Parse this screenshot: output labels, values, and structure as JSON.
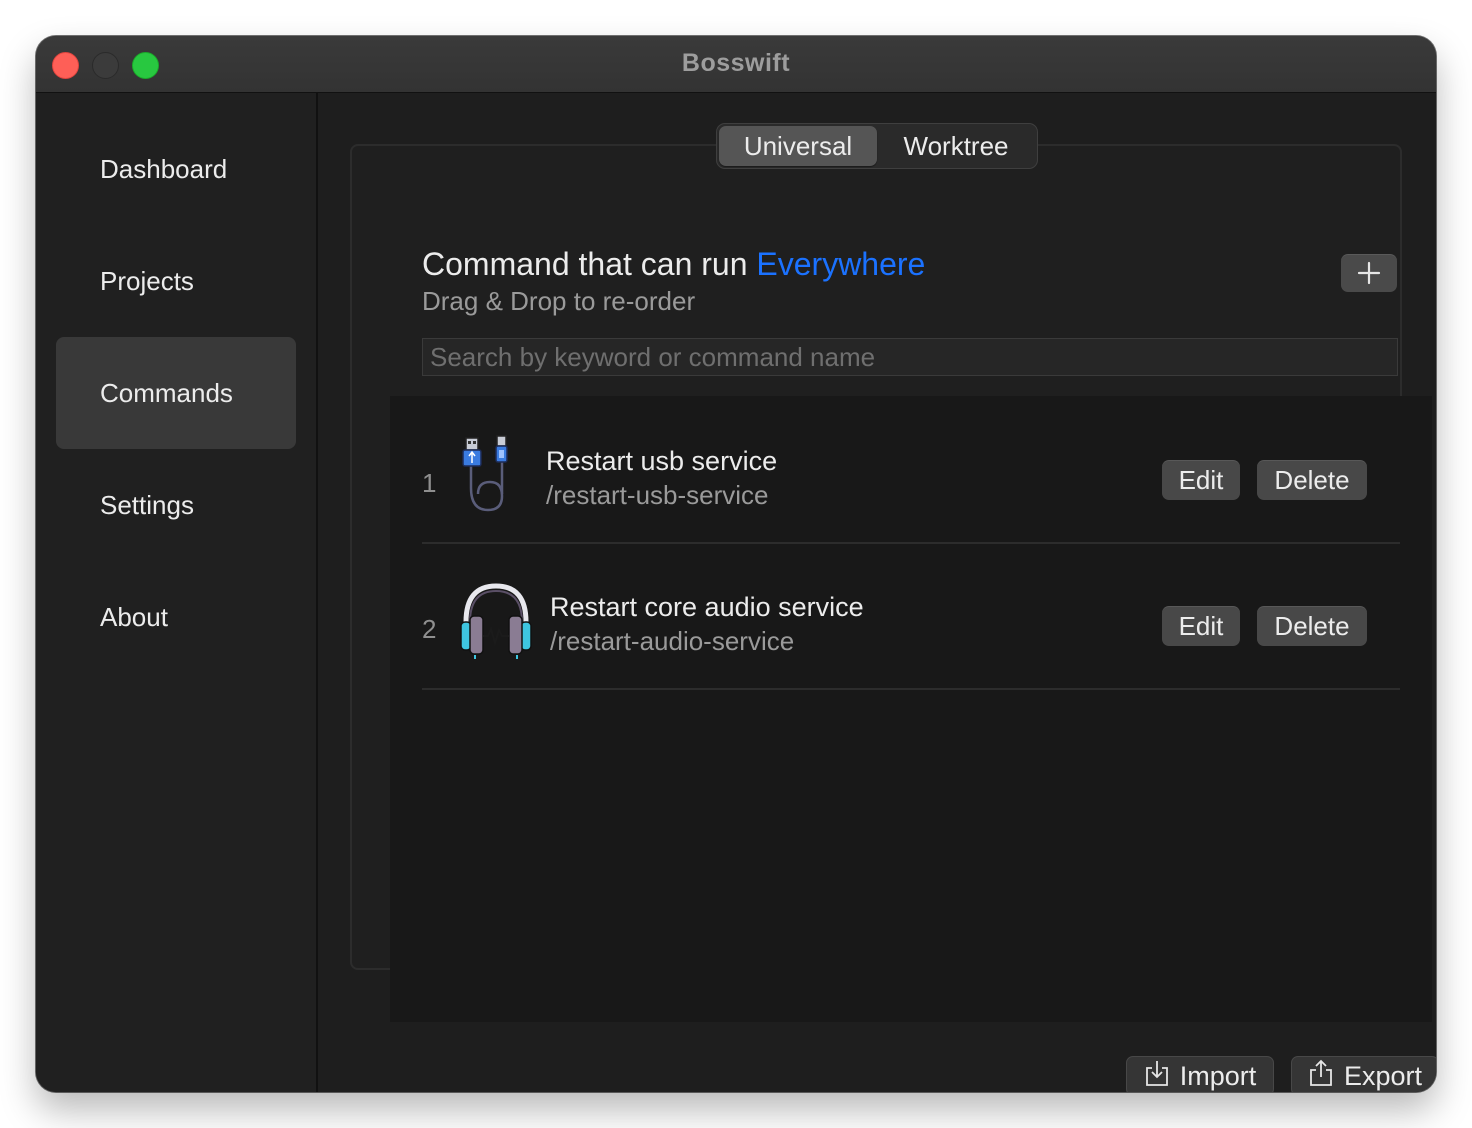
{
  "window": {
    "title": "Bosswift"
  },
  "sidebar": {
    "items": [
      {
        "label": "Dashboard"
      },
      {
        "label": "Projects"
      },
      {
        "label": "Commands",
        "active": true
      },
      {
        "label": "Settings"
      },
      {
        "label": "About"
      }
    ]
  },
  "scope_tabs": [
    {
      "label": "Universal",
      "selected": true
    },
    {
      "label": "Worktree"
    }
  ],
  "header": {
    "title_prefix": "Command that can run",
    "title_accent": "Everywhere",
    "subtitle": "Drag & Drop to re-order",
    "add_icon": "plus-icon"
  },
  "search": {
    "placeholder": "Search by keyword or command name",
    "value": ""
  },
  "commands": [
    {
      "index": "1",
      "icon": "usb-cable-icon",
      "name": "Restart usb service",
      "command": "/restart-usb-service",
      "edit_label": "Edit",
      "delete_label": "Delete"
    },
    {
      "index": "2",
      "icon": "headphones-icon",
      "name": "Restart core audio service",
      "command": "/restart-audio-service",
      "edit_label": "Edit",
      "delete_label": "Delete"
    }
  ],
  "footer": {
    "import_label": "Import",
    "import_icon": "import-icon",
    "export_label": "Export",
    "export_icon": "export-icon"
  },
  "colors": {
    "accent": "#1b72ff",
    "close": "#fe5f57",
    "minimize_disabled": "#3b3b3b",
    "maximize": "#28c840"
  }
}
